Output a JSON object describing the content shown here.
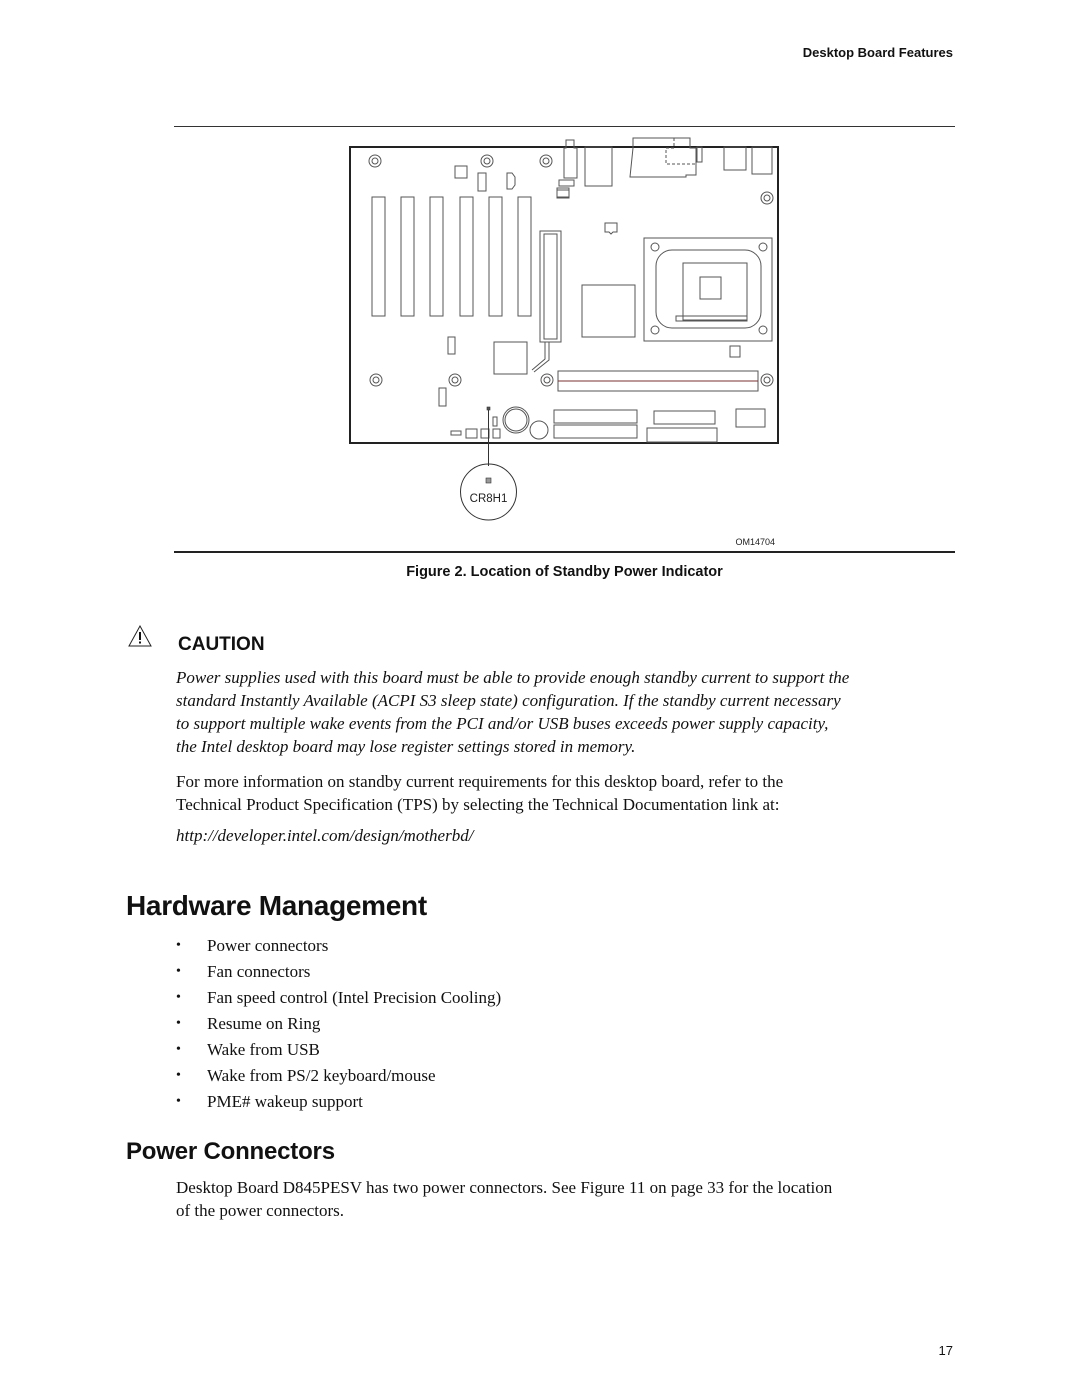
{
  "header": {
    "running_title": "Desktop Board Features"
  },
  "figure": {
    "callout_label": "CR8H1",
    "figure_id": "OM14704",
    "caption": "Figure 2.  Location of Standby Power Indicator"
  },
  "caution": {
    "icon": "warning-triangle-icon",
    "label": "CAUTION",
    "lines": [
      "Power supplies used with this board must be able to provide enough standby current to support the",
      "standard Instantly Available (ACPI S3 sleep state) configuration.  If the standby current necessary",
      "to support multiple wake events from the PCI and/or USB buses exceeds power supply capacity,",
      "the Intel desktop board may lose register settings stored in memory."
    ]
  },
  "info_paragraph": {
    "lines": [
      "For more information on standby current requirements for this desktop board, refer to the",
      "Technical Product Specification (TPS) by selecting the Technical Documentation link at:"
    ],
    "url": "http://developer.intel.com/design/motherbd/"
  },
  "hardware_management": {
    "heading": "Hardware Management",
    "bullet_glyph": "•",
    "items": [
      "Power connectors",
      "Fan connectors",
      "Fan speed control (Intel Precision Cooling)",
      "Resume on Ring",
      "Wake from USB",
      "Wake from PS/2 keyboard/mouse",
      "PME# wakeup support"
    ]
  },
  "power_connectors": {
    "heading": "Power Connectors",
    "lines": [
      "Desktop Board D845PESV has two power connectors.  See Figure 11 on page 33 for the location",
      "of the power connectors."
    ]
  },
  "footer": {
    "page_number": "17"
  }
}
